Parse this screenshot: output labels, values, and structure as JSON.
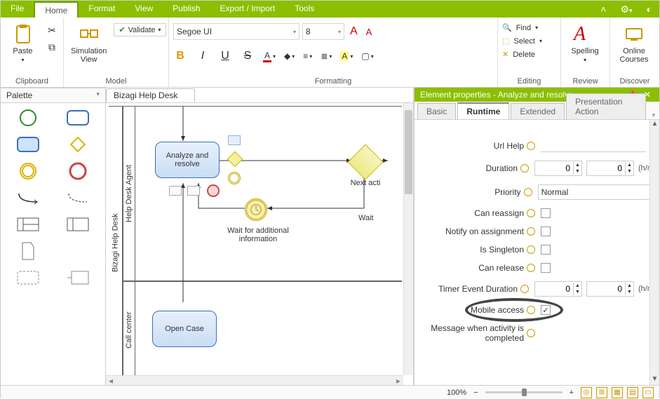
{
  "menubar": {
    "tabs": [
      "File",
      "Home",
      "Format",
      "View",
      "Publish",
      "Export / Import",
      "Tools"
    ],
    "active_index": 1
  },
  "ribbon": {
    "clipboard": {
      "paste": "Paste",
      "label": "Clipboard"
    },
    "model": {
      "simulation": "Simulation View",
      "validate": "Validate",
      "label": "Model"
    },
    "formatting": {
      "font_name": "Segoe UI",
      "font_size": "8",
      "bold": "B",
      "italic": "I",
      "underline": "U",
      "strike": "S",
      "label": "Formatting"
    },
    "editing": {
      "find": "Find",
      "select": "Select",
      "delete": "Delete",
      "label": "Editing"
    },
    "review": {
      "spelling": "Spelling",
      "label": "Review"
    },
    "discover": {
      "courses": "Online Courses",
      "label": "Discover"
    }
  },
  "palette": {
    "title": "Palette"
  },
  "canvas": {
    "doc_tab": "Bizagi Help Desk",
    "pool": "Bizagi Help Desk",
    "lane1": "Help Desk Agent",
    "lane2": "Call center",
    "task_analyze": "Analyze and resolve",
    "task_open": "Open Case",
    "gateway_label": "Next acti",
    "wait_label": "Wait",
    "timer_label": "Wait for additional information"
  },
  "props": {
    "title": "Element properties - Analyze and resolve",
    "tabs": [
      "Basic",
      "Runtime",
      "Extended",
      "Presentation Action"
    ],
    "active_tab": 1,
    "fields": {
      "url_help": "Url Help",
      "duration": "Duration",
      "duration_v1": "0",
      "duration_v2": "0",
      "duration_unit": "(h/m",
      "priority": "Priority",
      "priority_value": "Normal",
      "can_reassign": "Can reassign",
      "notify": "Notify on assignment",
      "singleton": "Is Singleton",
      "can_release": "Can release",
      "timer": "Timer Event Duration",
      "timer_v1": "0",
      "timer_v2": "0",
      "timer_unit": "(h/m",
      "mobile": "Mobile access",
      "completed": "Message when activity is completed"
    }
  },
  "status": {
    "zoom": "100%"
  }
}
